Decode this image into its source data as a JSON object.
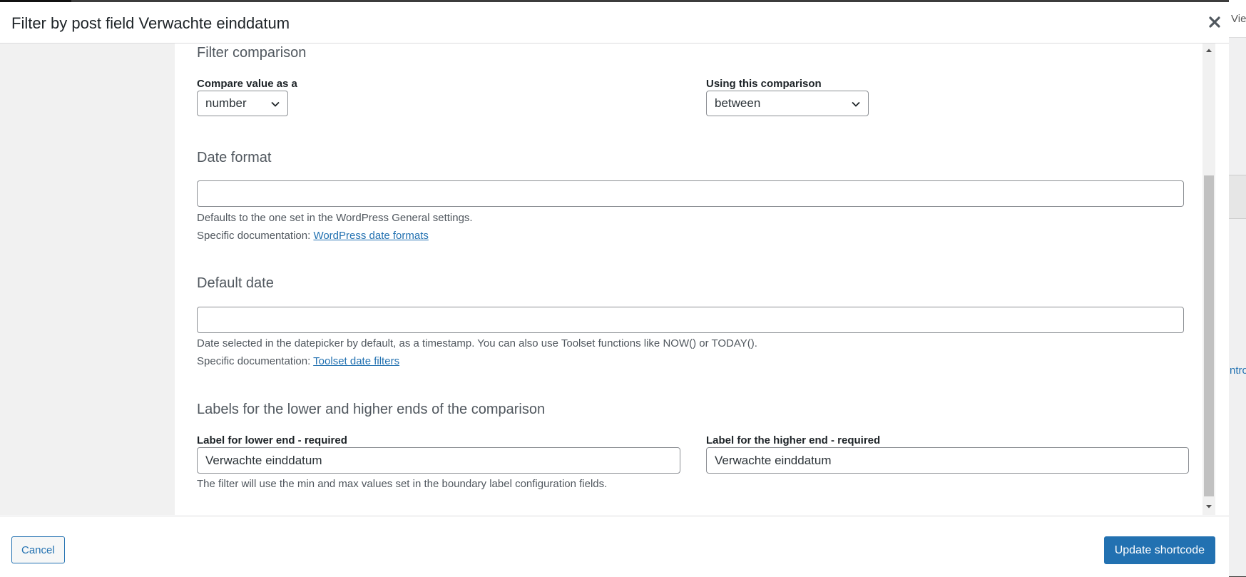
{
  "dialog": {
    "title": "Filter by post field Verwachte einddatum",
    "close_icon": "close-icon"
  },
  "background_page": {
    "header_text_fragment": "Vie",
    "tab_text_fragment": "ntro"
  },
  "filter_comparison": {
    "title": "Filter comparison",
    "compare_as_label": "Compare value as a",
    "compare_as_value": "number",
    "comparison_label": "Using this comparison",
    "comparison_value": "between"
  },
  "date_format": {
    "title": "Date format",
    "value": "",
    "help": "Defaults to the one set in the WordPress General settings.",
    "doc_prefix": "Specific documentation:",
    "doc_link": "WordPress date formats"
  },
  "default_date": {
    "title": "Default date",
    "value": "",
    "help": "Date selected in the datepicker by default, as a timestamp. You can also use Toolset functions like NOW() or TODAY().",
    "doc_prefix": "Specific documentation:",
    "doc_link": "Toolset date filters"
  },
  "labels": {
    "title": "Labels for the lower and higher ends of the comparison",
    "lower_label": "Label for lower end - required",
    "lower_value": "Verwachte einddatum",
    "higher_label": "Label for the higher end - required",
    "higher_value": "Verwachte einddatum",
    "help": "The filter will use the min and max values set in the boundary label configuration fields."
  },
  "footer": {
    "cancel_label": "Cancel",
    "update_label": "Update shortcode"
  },
  "colors": {
    "accent": "#2271b1",
    "sidebar_bg": "#f1f1f1",
    "overlay": "#3c3c3c"
  }
}
